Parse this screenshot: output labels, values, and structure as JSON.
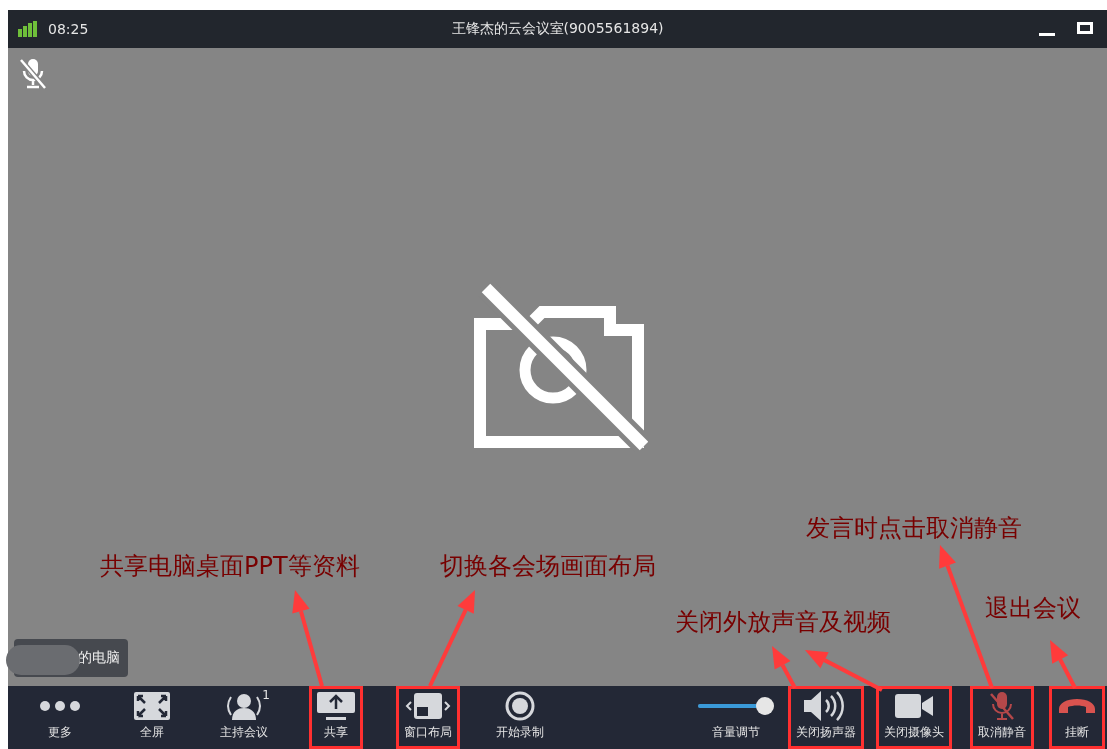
{
  "window": {
    "time": "08:25",
    "title": "王锋杰的云会议室(9005561894)"
  },
  "video": {
    "name_tag": "的电脑"
  },
  "toolbar": [
    {
      "kind": "more",
      "label": "更多",
      "highlighted": false
    },
    {
      "kind": "fullscreen",
      "label": "全屏",
      "highlighted": false
    },
    {
      "kind": "host",
      "label": "主持会议",
      "badge": "1",
      "highlighted": false
    },
    {
      "kind": "share",
      "label": "共享",
      "highlighted": true
    },
    {
      "kind": "layout",
      "label": "窗口布局",
      "highlighted": true
    },
    {
      "kind": "record",
      "label": "开始录制",
      "highlighted": false
    },
    {
      "kind": "volume",
      "label": "音量调节",
      "level": 0.9,
      "highlighted": false
    },
    {
      "kind": "speaker",
      "label": "关闭扬声器",
      "highlighted": true
    },
    {
      "kind": "camera",
      "label": "关闭摄像头",
      "highlighted": true
    },
    {
      "kind": "mic",
      "label": "取消静音",
      "muted": true,
      "highlighted": true
    },
    {
      "kind": "hangup",
      "label": "挂断",
      "highlighted": true
    }
  ],
  "annotations": [
    {
      "text": "共享电脑桌面PPT等资料"
    },
    {
      "text": "切换各会场画面布局"
    },
    {
      "text": "关闭外放声音及视频"
    },
    {
      "text": "发言时点击取消静音"
    },
    {
      "text": "退出会议"
    }
  ]
}
